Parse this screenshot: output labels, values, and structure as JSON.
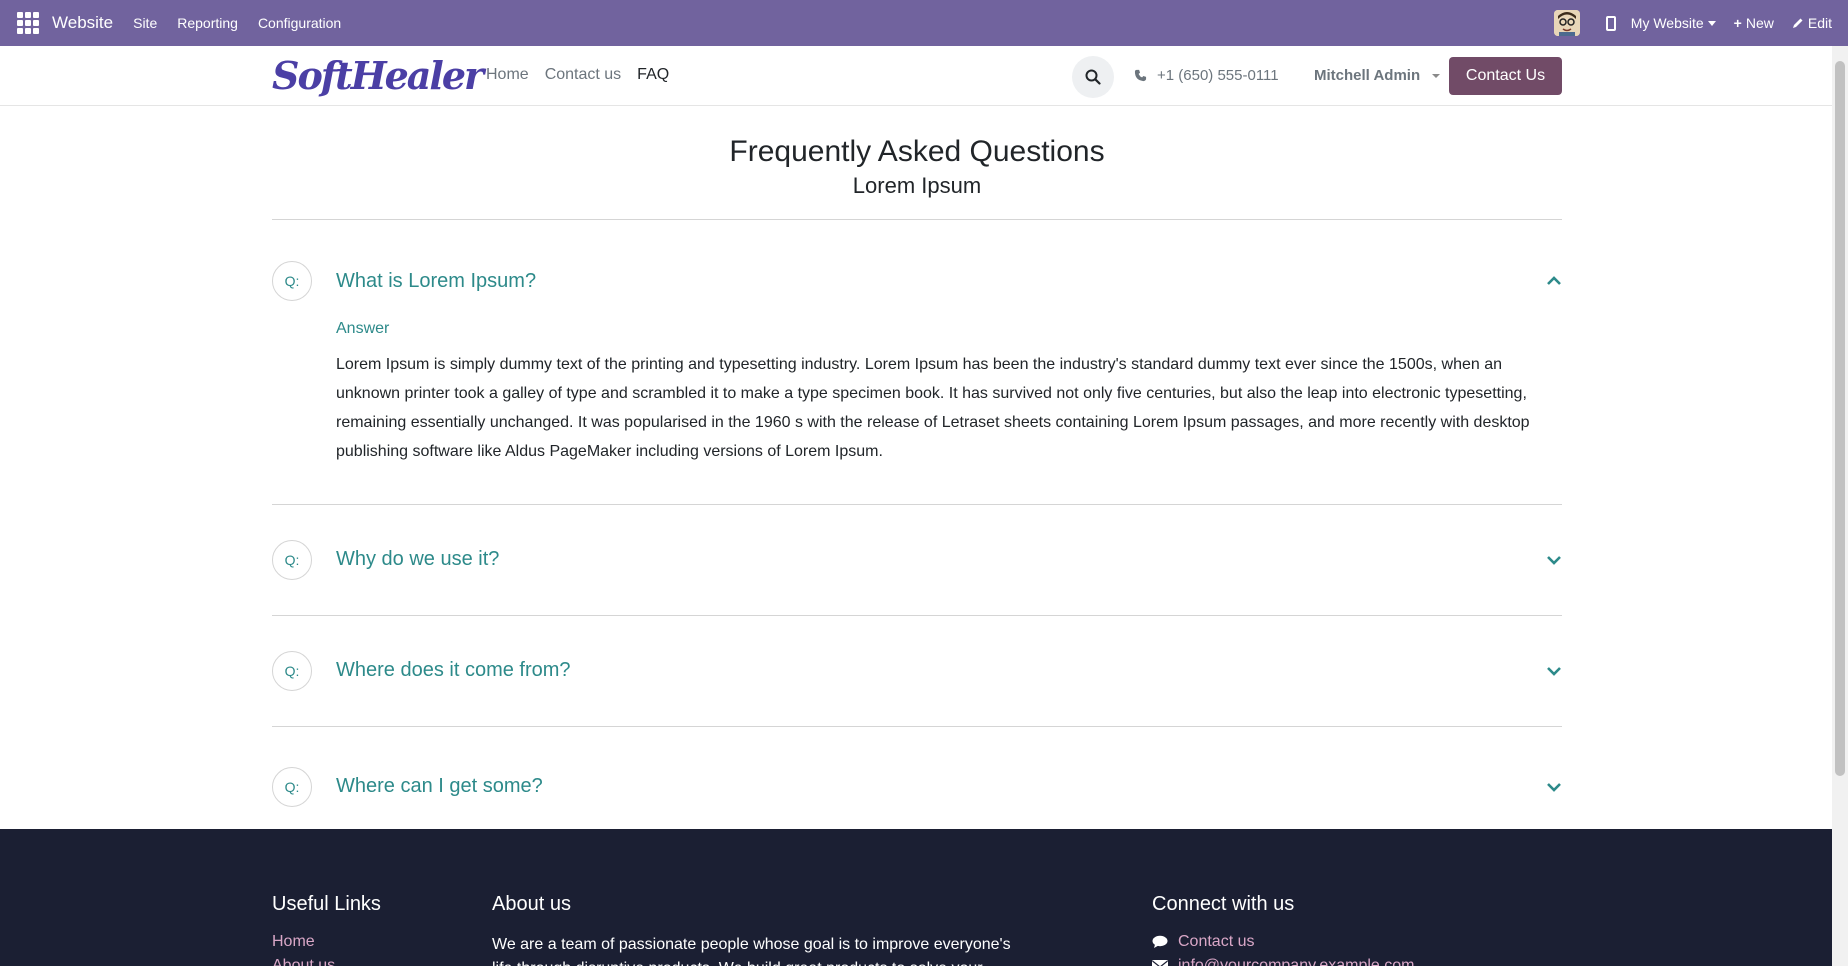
{
  "adminbar": {
    "brand": "Website",
    "menus": [
      "Site",
      "Reporting",
      "Configuration"
    ],
    "website_label": "My Website",
    "new_label": "New",
    "edit_label": "Edit",
    "bg_color": "#71639e"
  },
  "header": {
    "logo_text": "SoftHealer",
    "nav": [
      "Home",
      "Contact us",
      "FAQ"
    ],
    "active_nav": "FAQ",
    "phone": "+1 (650) 555-0111",
    "user": "Mitchell Admin",
    "contact_button": "Contact Us",
    "accent_color": "#714b67"
  },
  "faq": {
    "title": "Frequently Asked Questions",
    "subtitle": "Lorem Ipsum",
    "badge": "Q:",
    "items": [
      {
        "question": "What is Lorem Ipsum?",
        "expanded": true,
        "answer_label": "Answer",
        "answer": "Lorem Ipsum is simply dummy text of the printing and typesetting industry. Lorem Ipsum has been the industry's standard dummy text ever since the 1500s, when an unknown printer took a galley of type and scrambled it to make a type specimen book. It has survived not only five centuries, but also the leap into electronic typesetting, remaining essentially unchanged. It was popularised in the 1960 s with the release of Letraset sheets containing Lorem Ipsum passages, and more recently with desktop publishing software like Aldus PageMaker including versions of Lorem Ipsum."
      },
      {
        "question": "Why do we use it?",
        "expanded": false
      },
      {
        "question": "Where does it come from?",
        "expanded": false
      },
      {
        "question": "Where can I get some?",
        "expanded": false
      }
    ],
    "accent_color": "#2d8a8a"
  },
  "footer": {
    "useful_links_title": "Useful Links",
    "links": [
      "Home",
      "About us"
    ],
    "about_title": "About us",
    "about_text": "We are a team of passionate people whose goal is to improve everyone's life through disruptive products. We build great products to solve your",
    "connect_title": "Connect with us",
    "connect_items": [
      "Contact us",
      "info@yourcompany.example.com"
    ],
    "bg_color": "#1b1f33"
  }
}
